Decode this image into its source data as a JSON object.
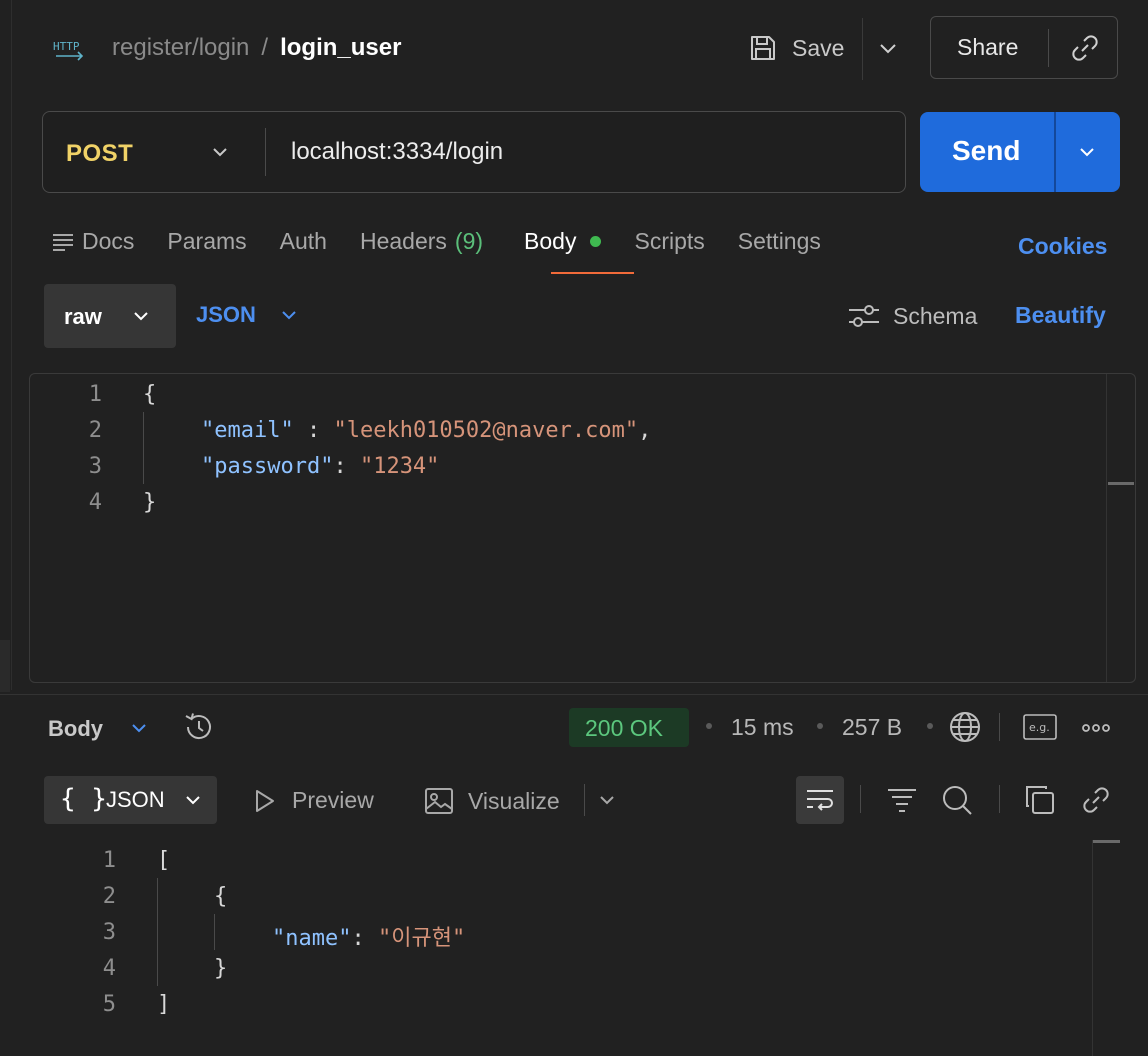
{
  "header": {
    "icon_text": "HTTP",
    "breadcrumb_parent": "register/login",
    "breadcrumb_separator": "/",
    "request_name": "login_user",
    "save_label": "Save",
    "share_label": "Share"
  },
  "request": {
    "method": "POST",
    "url": "localhost:3334/login",
    "send_label": "Send"
  },
  "tabs": {
    "docs": "Docs",
    "params": "Params",
    "auth": "Auth",
    "headers": "Headers",
    "headers_count": "(9)",
    "body": "Body",
    "scripts": "Scripts",
    "settings": "Settings",
    "cookies": "Cookies"
  },
  "body_options": {
    "mode": "raw",
    "language": "JSON",
    "schema_label": "Schema",
    "beautify_label": "Beautify"
  },
  "request_body": {
    "line_numbers": [
      "1",
      "2",
      "3",
      "4"
    ],
    "open_brace": "{",
    "close_brace": "}",
    "email_key": "\"email\"",
    "email_sep": " : ",
    "email_value": "\"leekh010502@naver.com\"",
    "comma": ",",
    "password_key": "\"password\"",
    "password_sep": ": ",
    "password_value": "\"1234\""
  },
  "response": {
    "body_label": "Body",
    "status": "200 OK",
    "time": "15 ms",
    "size": "257 B",
    "format": "JSON",
    "format_braces": "{ }",
    "preview_label": "Preview",
    "visualize_label": "Visualize",
    "eg_label": "e.g."
  },
  "response_body": {
    "line_numbers": [
      "1",
      "2",
      "3",
      "4",
      "5"
    ],
    "open_bracket": "[",
    "open_brace": "{",
    "name_key": "\"name\"",
    "name_sep": ": ",
    "name_value": "\"이규현\"",
    "close_brace": "}",
    "close_bracket": "]"
  },
  "colors": {
    "accent": "#1f6bdc",
    "link": "#4d8ff0",
    "method": "#f0d267",
    "status_ok": "#5cc77e",
    "tab_underline": "#f26b3a"
  }
}
